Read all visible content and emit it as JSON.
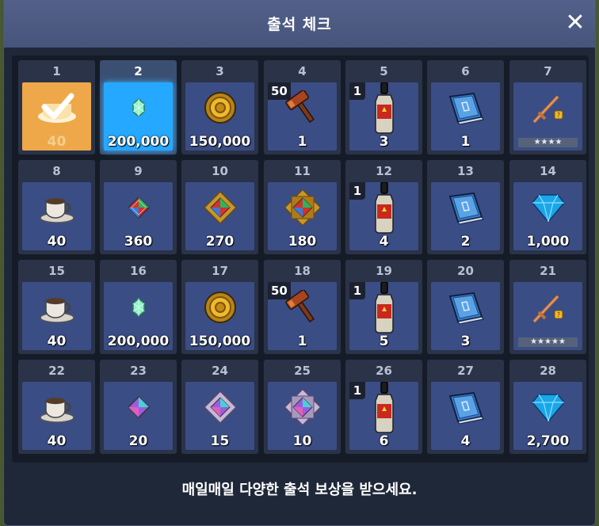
{
  "window": {
    "title": "출석 체크"
  },
  "footer": {
    "message": "매일매일 다양한 출석 보상을 받으세요."
  },
  "days": [
    {
      "day": "1",
      "item": "coffee",
      "qty": "40",
      "state": "claimed"
    },
    {
      "day": "2",
      "item": "small-gem",
      "qty": "200,000",
      "state": "current"
    },
    {
      "day": "3",
      "item": "gold-coin",
      "qty": "150,000"
    },
    {
      "day": "4",
      "item": "hammer",
      "qty": "1",
      "badge": "50"
    },
    {
      "day": "5",
      "item": "potion",
      "qty": "3",
      "badge": "1"
    },
    {
      "day": "6",
      "item": "book",
      "qty": "1"
    },
    {
      "day": "7",
      "item": "sword",
      "qty": "",
      "stars": "★★★★"
    },
    {
      "day": "8",
      "item": "coffee",
      "qty": "40"
    },
    {
      "day": "9",
      "item": "rainbow-gem",
      "qty": "360"
    },
    {
      "day": "10",
      "item": "rainbow-gem-frame",
      "qty": "270"
    },
    {
      "day": "11",
      "item": "rainbow-gem-ornate",
      "qty": "180"
    },
    {
      "day": "12",
      "item": "potion",
      "qty": "4",
      "badge": "1"
    },
    {
      "day": "13",
      "item": "book",
      "qty": "2"
    },
    {
      "day": "14",
      "item": "diamond",
      "qty": "1,000"
    },
    {
      "day": "15",
      "item": "coffee",
      "qty": "40"
    },
    {
      "day": "16",
      "item": "small-gem",
      "qty": "200,000"
    },
    {
      "day": "17",
      "item": "gold-coin",
      "qty": "150,000"
    },
    {
      "day": "18",
      "item": "hammer",
      "qty": "1",
      "badge": "50"
    },
    {
      "day": "19",
      "item": "potion",
      "qty": "5",
      "badge": "1"
    },
    {
      "day": "20",
      "item": "book",
      "qty": "3"
    },
    {
      "day": "21",
      "item": "sword",
      "qty": "",
      "stars": "★★★★★"
    },
    {
      "day": "22",
      "item": "coffee",
      "qty": "40"
    },
    {
      "day": "23",
      "item": "prism-gem",
      "qty": "20"
    },
    {
      "day": "24",
      "item": "prism-gem-frame",
      "qty": "15"
    },
    {
      "day": "25",
      "item": "prism-gem-ornate",
      "qty": "10"
    },
    {
      "day": "26",
      "item": "potion",
      "qty": "6",
      "badge": "1"
    },
    {
      "day": "27",
      "item": "book",
      "qty": "4"
    },
    {
      "day": "28",
      "item": "diamond",
      "qty": "2,700"
    }
  ]
}
